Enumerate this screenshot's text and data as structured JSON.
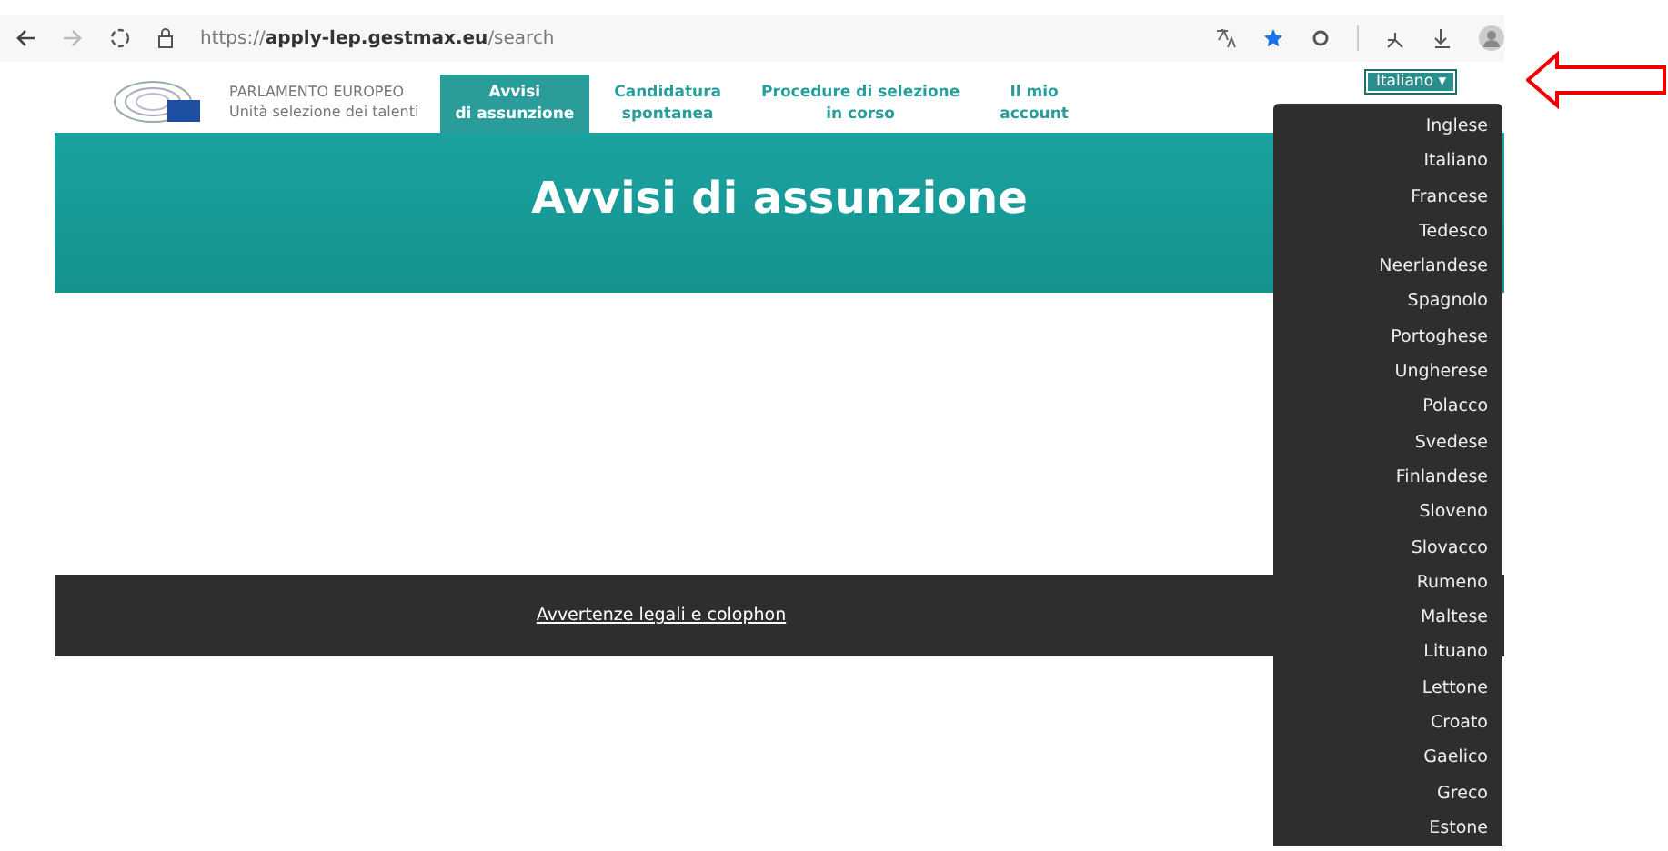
{
  "browser": {
    "url_prefix": "https://",
    "url_host": "apply-lep.gestmax.eu",
    "url_path": "/search"
  },
  "header": {
    "org_name": "PARLAMENTO EUROPEO",
    "org_unit": "Unità selezione dei talenti",
    "nav": [
      {
        "line1": "Avvisi",
        "line2": "di assunzione",
        "selected": true
      },
      {
        "line1": "Candidatura",
        "line2": "spontanea",
        "selected": false
      },
      {
        "line1": "Procedure di selezione",
        "line2": "in corso",
        "selected": false
      },
      {
        "line1": "Il mio",
        "line2": "account",
        "selected": false
      }
    ],
    "language_button": {
      "label": "Italiano",
      "caret": "▾",
      "expanded": true
    }
  },
  "banner": {
    "title": "Avvisi di assunzione"
  },
  "footer": {
    "link": "Avvertenze legali e colophon"
  },
  "language_menu": [
    "Inglese",
    "Italiano",
    "Francese",
    "Tedesco",
    "Neerlandese",
    "Spagnolo",
    "Portoghese",
    "Ungherese",
    "Polacco",
    "Svedese",
    "Finlandese",
    "Sloveno",
    "Slovacco",
    "Rumeno",
    "Maltese",
    "Lituano",
    "Lettone",
    "Croato",
    "Gaelico",
    "Greco",
    "Estone"
  ]
}
